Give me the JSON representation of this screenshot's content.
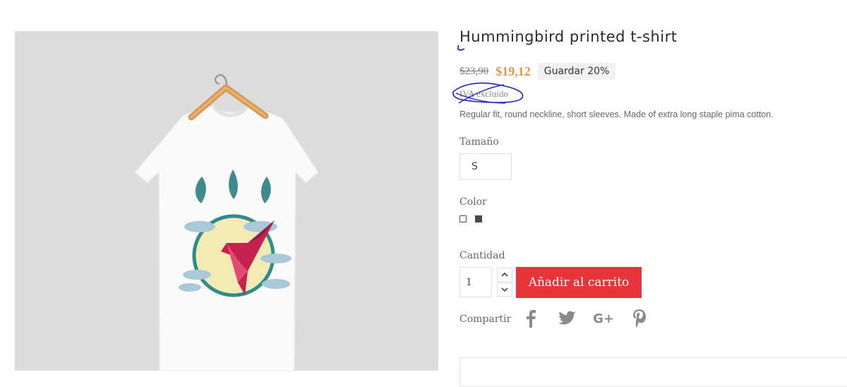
{
  "product": {
    "title": "Hummingbird printed t-shirt",
    "old_price": "$23,90",
    "new_price": "$19,12",
    "discount_label": "Guardar 20%",
    "tax_label": "IVA excluido",
    "description": "Regular fit, round neckline, short sleeves. Made of extra long staple pima cotton."
  },
  "size": {
    "label": "Tamaño",
    "selected": "S"
  },
  "color": {
    "label": "Color",
    "options": [
      "#ffffff",
      "#434a54"
    ]
  },
  "quantity": {
    "label": "Cantidad",
    "value": "1"
  },
  "cart": {
    "button_label": "Añadir al carrito",
    "accent": "#e8343a"
  },
  "share": {
    "label": "Compartir",
    "icons": [
      "facebook-icon",
      "twitter-icon",
      "google-plus-icon",
      "pinterest-icon"
    ],
    "google_plus_text": "G+"
  },
  "colors": {
    "price_accent": "#e0964b",
    "annotation": "#1a23c9"
  }
}
